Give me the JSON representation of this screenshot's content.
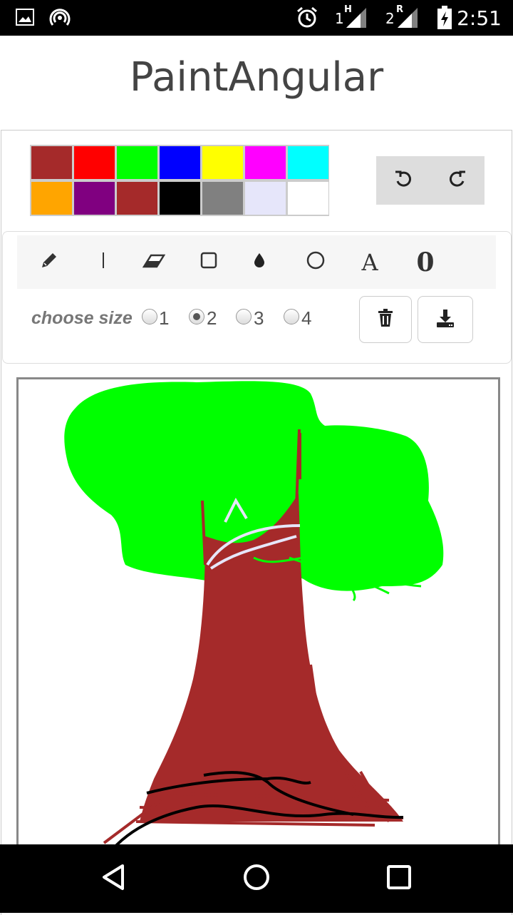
{
  "status_bar": {
    "time": "2:51",
    "sim1": "1",
    "sim1_type": "H",
    "sim2": "2",
    "sim2_type": "R",
    "icons": [
      "gallery-icon",
      "hotspot-icon",
      "alarm-icon",
      "signal-icon",
      "battery-charging-icon"
    ]
  },
  "app": {
    "title": "PaintAngular"
  },
  "palette": {
    "colors": [
      "#a52a2a",
      "#ff0000",
      "#00ff00",
      "#0000ff",
      "#ffff00",
      "#ff00ff",
      "#00ffff",
      "#ffa500",
      "#800080",
      "#a52a2a",
      "#000000",
      "#808080",
      "#e6e6fa",
      "#ffffff"
    ]
  },
  "history": {
    "icons": [
      "undo-icon",
      "redo-icon"
    ]
  },
  "tools": {
    "items": [
      {
        "name": "pencil-icon"
      },
      {
        "name": "line-icon"
      },
      {
        "name": "eraser-icon"
      },
      {
        "name": "rectangle-icon"
      },
      {
        "name": "fill-icon"
      },
      {
        "name": "circle-icon"
      },
      {
        "name": "text-tool",
        "glyph": "A"
      },
      {
        "name": "ellipse-tool",
        "glyph": "0"
      }
    ]
  },
  "size": {
    "label": "choose size",
    "options": [
      "1",
      "2",
      "3",
      "4"
    ],
    "selected": "2"
  },
  "actions": {
    "icons": [
      "trash-icon",
      "download-icon"
    ]
  },
  "drawing": {
    "colors": {
      "foliage": "#00ff00",
      "trunk": "#a52a2a",
      "roots": "#000000",
      "highlight": "#e6e6fa"
    }
  },
  "nav_bar": {
    "icons": [
      "back-icon",
      "home-icon",
      "recents-icon"
    ]
  }
}
